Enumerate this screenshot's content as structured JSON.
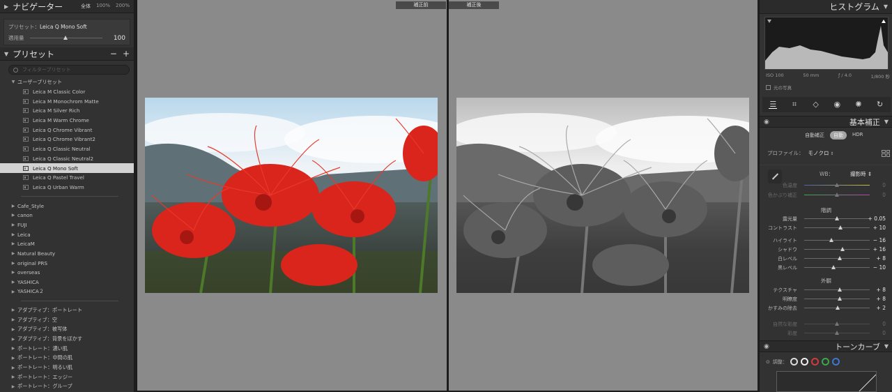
{
  "navigator": {
    "title": "ナビゲーター",
    "zoom_fit": "全体",
    "zoom_100": "100%",
    "zoom_200": "200%"
  },
  "preset_box": {
    "preset_label": "プリセット：",
    "preset_name": "Leica Q Mono Soft",
    "amount_label": "適用量",
    "amount_value": "100",
    "amount_level": 100
  },
  "presets_panel": {
    "title": "プリセット",
    "minus": "−",
    "plus": "+",
    "filter_placeholder": "フィルタープリセット",
    "user_group": "ユーザープリセット",
    "user_items": [
      "Leica M Classic Color",
      "Leica M Monochrom Matte",
      "Leica M Silver Rich",
      "Leica M Warm Chrome",
      "Leica Q Chrome Vibrant",
      "Leica Q Chrome Vibrant2",
      "Leica Q Classic Neutral",
      "Leica Q Classic Neutral2",
      "Leica Q Mono Soft",
      "Leica Q Pastel Travel",
      "Leica Q Urban Warm"
    ],
    "selected_index": 8,
    "groups": [
      "Cafe_Style",
      "canon",
      "FUJI",
      "Leica",
      "LeicaM",
      "Natural Beauty",
      "original PRS",
      "overseas",
      "YASHICA",
      "YASHICA２"
    ],
    "adaptive_groups": [
      "アダプティブ：ポートレート",
      "アダプティブ：空",
      "アダプティブ：被写体",
      "アダプティブ：背景をぼかす",
      "ポートレート：濃い肌",
      "ポートレート：中間の肌",
      "ポートレート：明るい肌",
      "ポートレート：エッジー",
      "ポートレート：グループ"
    ]
  },
  "views": {
    "before_label": "補正前",
    "after_label": "補正後"
  },
  "histogram": {
    "title": "ヒストグラム",
    "iso": "ISO 100",
    "focal": "50 mm",
    "aperture": "ƒ / 4.0",
    "shutter": "1/800 秒",
    "original_photo": "元の写真"
  },
  "icons": {
    "eye": "eye-icon",
    "tools": [
      "sliders-icon",
      "crop-icon",
      "eraser-icon",
      "redeye-icon",
      "mask-icon",
      "reset-icon"
    ]
  },
  "basic": {
    "title": "基本補正",
    "modes": [
      "自動補正",
      "自動",
      "HDR"
    ],
    "selected_mode": 1,
    "profile_label": "プロファイル：",
    "profile_value": "モノクロ",
    "wb_label": "WB：",
    "wb_value": "撮影時 ⇕",
    "wb_sliders": [
      {
        "label": "色温度",
        "value": "0",
        "level": 0.5,
        "dim": true
      },
      {
        "label": "色かぶり補正",
        "value": "0",
        "level": 0.5,
        "dim": true
      }
    ],
    "tone_header": "階調",
    "tone_sliders": [
      {
        "label": "露光量",
        "value": "+ 0.05",
        "level": 0.505
      },
      {
        "label": "コントラスト",
        "value": "+ 10",
        "level": 0.55
      }
    ],
    "tone_sliders2": [
      {
        "label": "ハイライト",
        "value": "− 16",
        "level": 0.42
      },
      {
        "label": "シャドウ",
        "value": "+ 16",
        "level": 0.58
      },
      {
        "label": "白レベル",
        "value": "+ 8",
        "level": 0.54
      },
      {
        "label": "黒レベル",
        "value": "− 10",
        "level": 0.45
      }
    ],
    "presence_header": "外観",
    "presence_sliders": [
      {
        "label": "テクスチャ",
        "value": "+ 8",
        "level": 0.54
      },
      {
        "label": "明瞭度",
        "value": "+ 8",
        "level": 0.54
      },
      {
        "label": "かすみの除去",
        "value": "+ 2",
        "level": 0.51
      }
    ],
    "color_sliders": [
      {
        "label": "自然な彩度",
        "value": "0",
        "level": 0.5,
        "dim": true
      },
      {
        "label": "彩度",
        "value": "0",
        "level": 0.5,
        "dim": true
      }
    ]
  },
  "tone_curve": {
    "title": "トーンカーブ",
    "adjust_label": "調整："
  }
}
